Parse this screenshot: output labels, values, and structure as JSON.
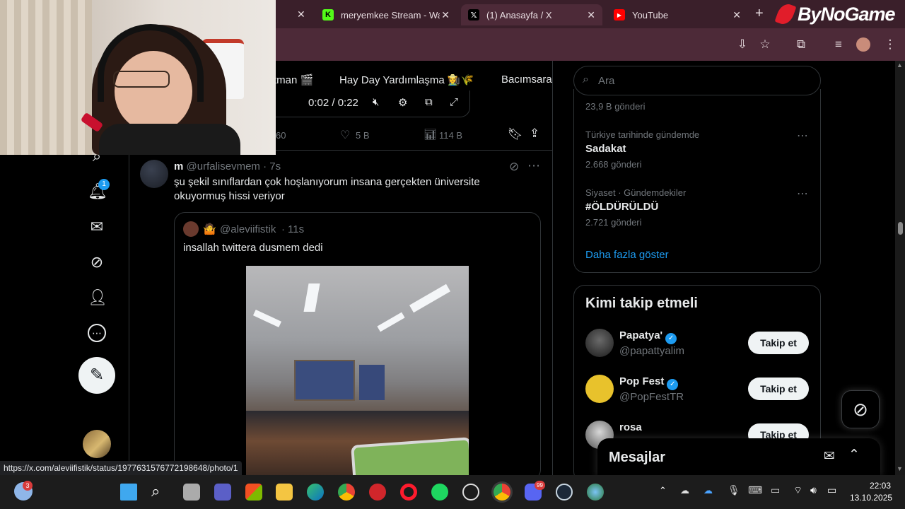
{
  "browser": {
    "tabs": [
      {
        "label": "meryemkee Stream - Wa",
        "icon": "kick-icon",
        "color": "#53fc18"
      },
      {
        "label": "(1) Anasayfa / X",
        "icon": "x-logo-icon",
        "color": "#000000",
        "active": true
      },
      {
        "label": "YouTube",
        "icon": "youtube-icon",
        "color": "#ff0000"
      }
    ],
    "new_tab_label": "+",
    "close_glyph": "✕",
    "status_url": "https://x.com/aleviifistik/status/1977631576772198648/photo/1"
  },
  "overlay": {
    "brand": "ByNoGame"
  },
  "topics": {
    "items": [
      "tman 🎬",
      "Hay Day Yardımlaşma 👩‍🌾🌾",
      "Bacımsara"
    ]
  },
  "video": {
    "time": "0:02 / 0:22"
  },
  "prev_tweet": {
    "replies": "60",
    "likes": "5 B",
    "views": "114 B"
  },
  "nav": {
    "notification_badge": "1"
  },
  "tweet": {
    "name": "m",
    "handle": "@urfalisevmem",
    "dot": "·",
    "time": "7s",
    "text": "şu şekil sınıflardan çok hoşlanıyorum insana gerçekten üniversite okuyormuş hissi veriyor",
    "quote": {
      "emoji": "🤷",
      "handle": "@aleviifistik",
      "time": "11s",
      "text": "insallah twittera dusmem dedi"
    }
  },
  "search": {
    "placeholder": "Ara"
  },
  "trends": {
    "top_count": "23,9 B gönderi",
    "items": [
      {
        "meta": "Türkiye tarihinde gündemde",
        "title": "Sadakat",
        "count": "2.668 gönderi"
      },
      {
        "meta": "Siyaset · Gündemdekiler",
        "title": "#ÖLDÜRÜLDÜ",
        "count": "2.721 gönderi"
      }
    ],
    "more_label": "Daha fazla göster"
  },
  "who_to_follow": {
    "title": "Kimi takip etmeli",
    "follow_label": "Takip et",
    "users": [
      {
        "name": "Papatya'",
        "handle": "@papattyalim",
        "verified": true
      },
      {
        "name": "Pop Fest",
        "handle": "@PopFestTR",
        "verified": true
      },
      {
        "name": "rosa",
        "handle": "",
        "verified": false
      }
    ]
  },
  "messages": {
    "title": "Mesajlar"
  },
  "taskbar": {
    "weather_badge": "3",
    "discord_badge": "99",
    "time": "22:03",
    "date": "13.10.2025"
  },
  "colors": {
    "accent": "#1d9bf0",
    "tab_bar": "#3a1f2a",
    "toolbar": "#4d2a38"
  }
}
